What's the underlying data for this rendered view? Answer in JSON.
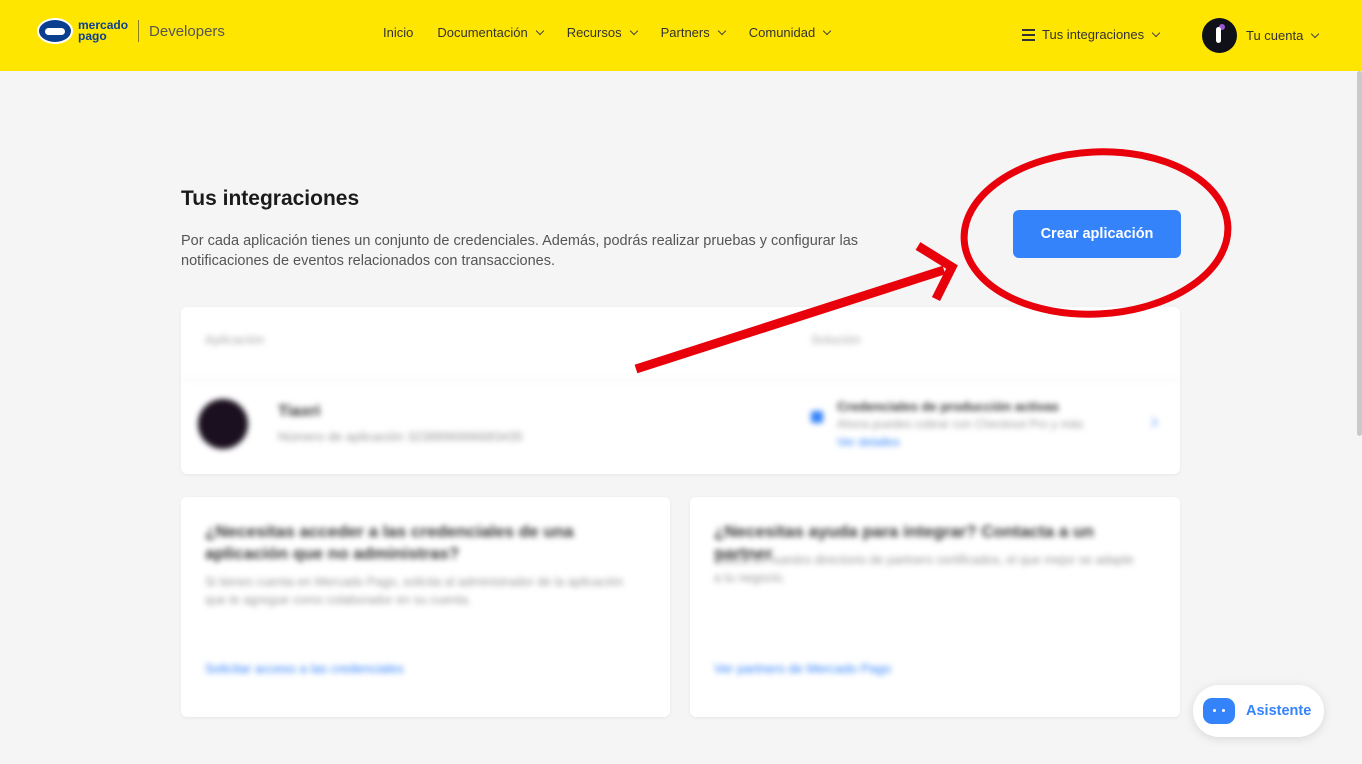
{
  "header": {
    "brand_top": "mercado",
    "brand_bottom": "pago",
    "brand_section": "Developers",
    "nav": [
      "Inicio",
      "Documentación",
      "Recursos",
      "Partners",
      "Comunidad"
    ],
    "integrations_menu": "Tus integraciones",
    "account_menu": "Tu cuenta",
    "background_color": "#ffe600"
  },
  "main": {
    "title": "Tus integraciones",
    "description": "Por cada aplicación tienes un conjunto de credenciales. Además, podrás realizar pruebas y configurar las notificaciones de eventos relacionados con transacciones.",
    "create_button": "Crear aplicación",
    "accent_color": "#3483fa"
  },
  "app_table": {
    "col_app": "Aplicación",
    "col_solution": "Solución",
    "app_name": "Tiaxri",
    "app_number": "Número de aplicación 3238896996683435",
    "status": "Credenciales de producción activas",
    "status_sub": "Ahora puedes cobrar con Checkout Pro y más",
    "status_link": "Ver detalles"
  },
  "cards": [
    {
      "title": "¿Necesitas acceder a las credenciales de una aplicación que no administras?",
      "body": "Si tienes cuenta en Mercado Pago, solicita al administrador de la aplicación que te agregue como colaborador en su cuenta.",
      "link": "Solicitar acceso a las credenciales"
    },
    {
      "title": "¿Necesitas ayuda para integrar? Contacta a un partner",
      "body": "Busca en nuestro directorio de partners certificados, el que mejor se adapte a tu negocio.",
      "link": "Ver partners de Mercado Pago"
    }
  ],
  "annotation": {
    "color": "#e8000a",
    "shapes": [
      "red-ellipse",
      "red-arrow"
    ]
  },
  "assistant": {
    "label": "Asistente"
  }
}
